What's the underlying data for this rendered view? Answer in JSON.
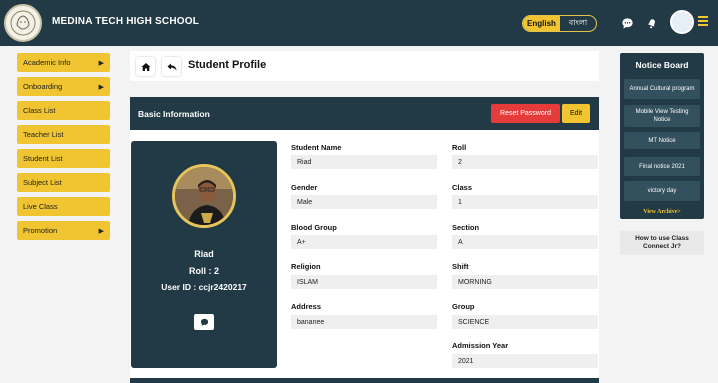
{
  "header": {
    "school_name": "MEDINA TECH HIGH SCHOOL",
    "lang_en": "English",
    "lang_bn": "বাংলা"
  },
  "sidebar": {
    "items": [
      {
        "label": "Academic Info",
        "has_submenu": true
      },
      {
        "label": "Onboarding",
        "has_submenu": true
      },
      {
        "label": "Class List",
        "has_submenu": false
      },
      {
        "label": "Teacher List",
        "has_submenu": false
      },
      {
        "label": "Student List",
        "has_submenu": false
      },
      {
        "label": "Subject List",
        "has_submenu": false
      },
      {
        "label": "Live Class",
        "has_submenu": false
      },
      {
        "label": "Promotion",
        "has_submenu": true
      }
    ]
  },
  "page": {
    "title": "Student Profile",
    "section_title": "Basic Information",
    "reset_password_label": "Reset Password",
    "edit_label": "Edit"
  },
  "profile": {
    "name": "Riad",
    "roll_label": "Roll :",
    "roll_value": "2",
    "user_id_label": "User ID :",
    "user_id_value": "ccjr2420217"
  },
  "fields": {
    "student_name": {
      "label": "Student Name",
      "value": "Riad"
    },
    "roll": {
      "label": "Roll",
      "value": "2"
    },
    "gender": {
      "label": "Gender",
      "value": "Male"
    },
    "class": {
      "label": "Class",
      "value": "1"
    },
    "blood_group": {
      "label": "Blood Group",
      "value": "A+"
    },
    "section": {
      "label": "Section",
      "value": "A"
    },
    "religion": {
      "label": "Religion",
      "value": "ISLAM"
    },
    "shift": {
      "label": "Shift",
      "value": "MORNING"
    },
    "address": {
      "label": "Address",
      "value": "bananee"
    },
    "group": {
      "label": "Group",
      "value": "SCIENCE"
    },
    "admission_year": {
      "label": "Admission Year",
      "value": "2021"
    }
  },
  "notice_board": {
    "title": "Notice Board",
    "items": [
      "Annual Cultural program",
      "Mobile View Testing Notice",
      "MT Notice",
      "Final notice 2021",
      "victory day"
    ],
    "archive_label": "View Archive>",
    "howto_label": "How to use Class Connect Jr?"
  },
  "colors": {
    "primary_dark": "#223a45",
    "accent_yellow": "#f0c531",
    "danger_red": "#e63b3b"
  }
}
